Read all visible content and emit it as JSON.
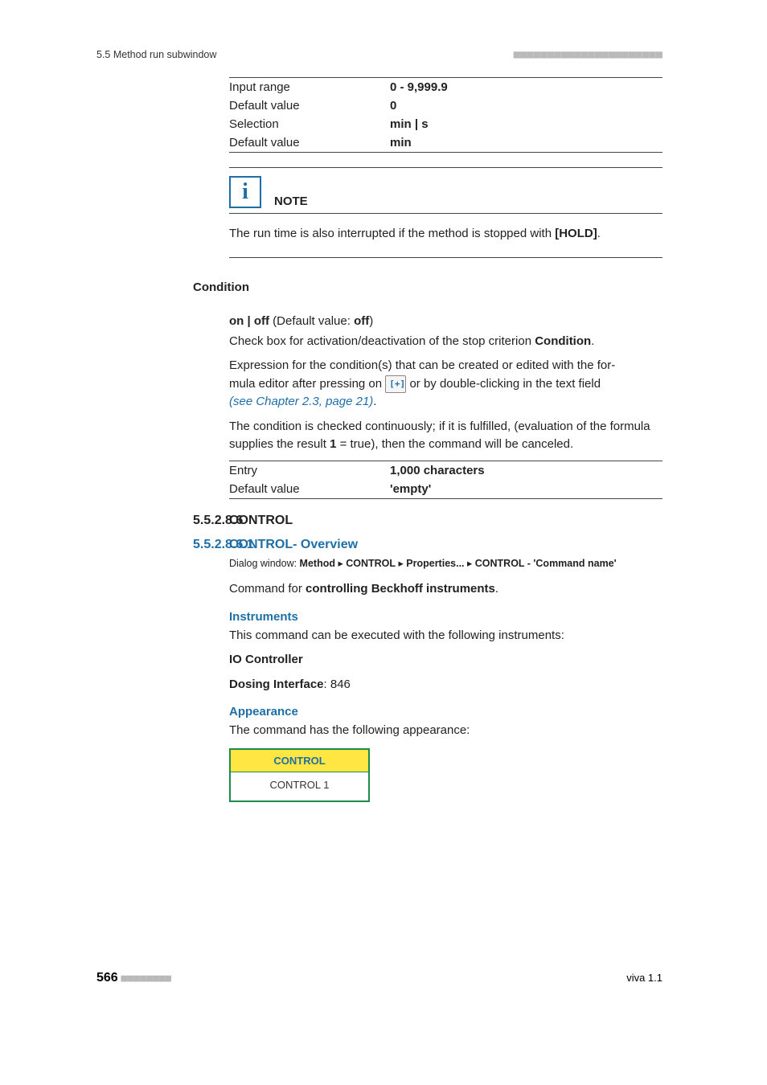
{
  "running_head": {
    "left": "5.5 Method run subwindow",
    "dashes": "■■■■■■■■■■■■■■■■■■■■■■"
  },
  "kv_top": {
    "r1k": "Input range",
    "r1v": "0 - 9,999.9",
    "r2k": "Default value",
    "r2v": "0",
    "r3k": "Selection",
    "r3v": "min | s",
    "r4k": "Default value",
    "r4v": "min"
  },
  "note": {
    "title": "NOTE",
    "body_pre": "The run time is also interrupted if the method is stopped with ",
    "body_hold": "[HOLD]",
    "body_post": "."
  },
  "condition": {
    "label": "Condition",
    "onoff_pre": "on | off",
    "onoff_mid": " (Default value: ",
    "onoff_val": "off",
    "onoff_post": ")",
    "p1_pre": "Check box for activation/deactivation of the stop criterion ",
    "p1_b": "Condition",
    "p1_post": ".",
    "p2a": "Expression for the condition(s) that can be created or edited with the for-",
    "p2b_pre": "mula editor after pressing on ",
    "p2b_post": " or by double-clicking in the text field ",
    "p2c": "(see Chapter 2.3, page 21)",
    "p2c_post": ".",
    "p3_pre": "The condition is checked continuously; if it is fulfilled, (evaluation of the formula supplies the result ",
    "p3_b": "1",
    "p3_post": " = true), then the command will be canceled."
  },
  "kv_cond": {
    "r1k": "Entry",
    "r1v": "1,000 characters",
    "r2k": "Default value",
    "r2v": "'empty'"
  },
  "sec": {
    "num": "5.5.2.8.6",
    "title": "CONTROL"
  },
  "subsec": {
    "num": "5.5.2.8.6.1",
    "title": "CONTROL- Overview"
  },
  "dialog": {
    "pre": "Dialog window: ",
    "p1": "Method",
    "sep": " ▸ ",
    "p2": "CONTROL",
    "p3": "Properties...",
    "p4": "CONTROL - 'Command name'"
  },
  "control": {
    "cmd_pre": "Command for ",
    "cmd_b": "controlling Beckhoff instruments",
    "cmd_post": ".",
    "instr_h": "Instruments",
    "instr_p": "This command can be executed with the following instruments:",
    "instr_b1": "IO Controller",
    "instr_b2_pre": "Dosing Interface",
    "instr_b2_post": ": 846",
    "app_h": "Appearance",
    "app_p": "The command has the following appearance:",
    "box_head": "CONTROL",
    "box_body": "CONTROL 1"
  },
  "footer": {
    "page": "566",
    "dashes": "■■■■■■■■",
    "right": "viva 1.1"
  }
}
